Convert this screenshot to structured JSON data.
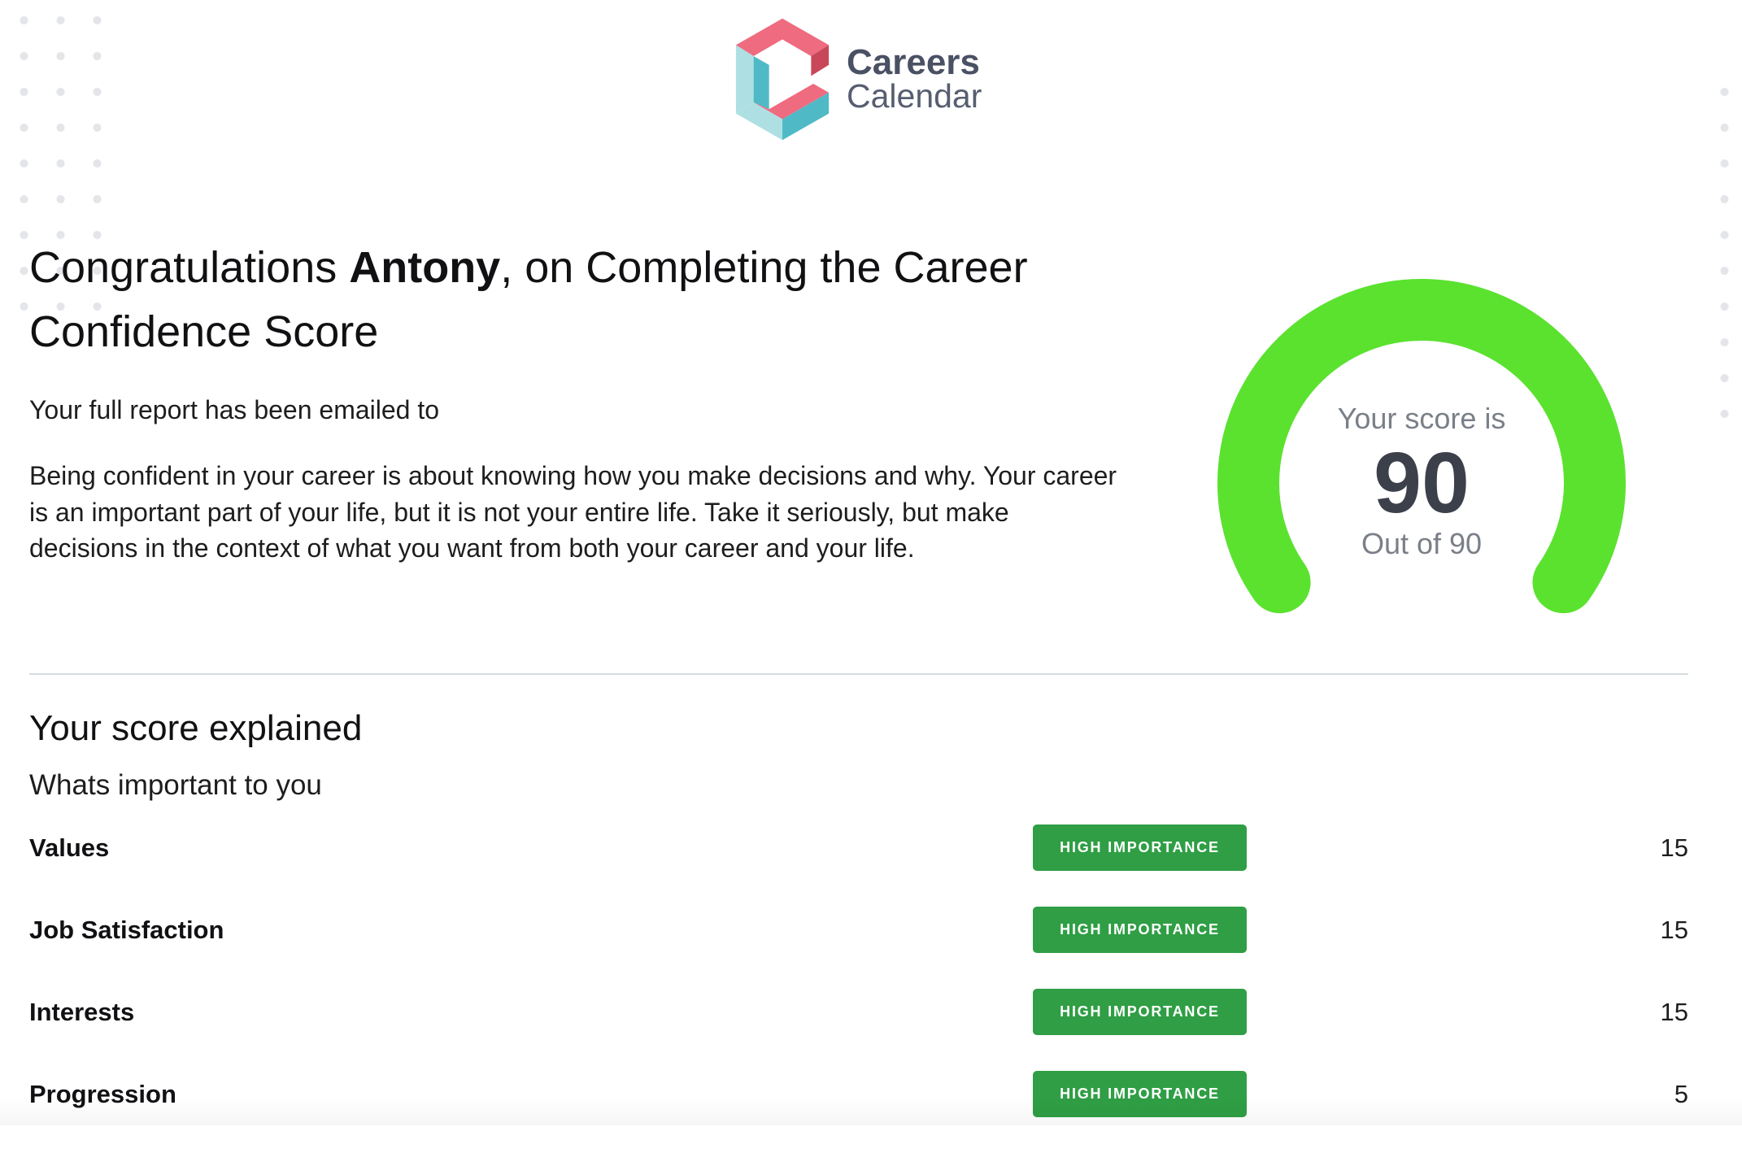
{
  "brand": {
    "name_line1": "Careers",
    "name_line2": "Calendar",
    "logo_icon": "careers-calendar-logo-icon",
    "colors": {
      "pink": "#ee6b80",
      "dark_pink": "#c8485a",
      "teal": "#4fbac6",
      "light_teal": "#aee0e3"
    }
  },
  "heading": {
    "prefix": "Congratulations ",
    "name": "Antony",
    "suffix": ", on Completing the Career Confidence Score"
  },
  "intro": {
    "emailed_text": "Your full report has been emailed to",
    "body_lines": [
      "Being confident in your career is about knowing how you make decisions and why. Your career",
      "is an important part of your life, but it is not your entire life. Take it seriously, but make",
      "decisions in the context of what you want from both your career and your life."
    ]
  },
  "score": {
    "label": "Your score is",
    "value": 90,
    "max": 90,
    "out_of_text": "Out of 90",
    "color": "#5be22f",
    "track_color": "#e6e8ec"
  },
  "explained": {
    "title": "Your score explained",
    "subtitle": "Whats important to you",
    "badge_color": "#2f9e44",
    "rows": [
      {
        "label": "Values",
        "badge": "HIGH IMPORTANCE",
        "score": "15"
      },
      {
        "label": "Job Satisfaction",
        "badge": "HIGH IMPORTANCE",
        "score": "15"
      },
      {
        "label": "Interests",
        "badge": "HIGH IMPORTANCE",
        "score": "15"
      },
      {
        "label": "Progression",
        "badge": "HIGH IMPORTANCE",
        "score": "5"
      }
    ]
  }
}
